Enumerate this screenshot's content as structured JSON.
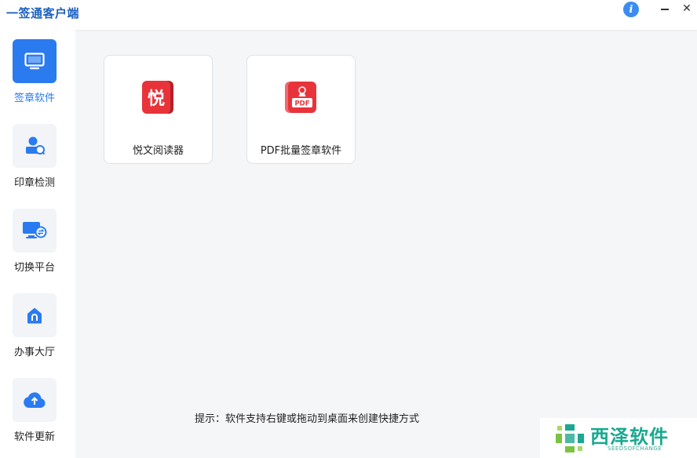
{
  "window": {
    "title": "一签通客户端"
  },
  "titlebar": {
    "info_glyph": "i",
    "close_glyph": "✕"
  },
  "sidebar": {
    "items": [
      {
        "label": "签章软件",
        "icon": "monitor-icon",
        "active": true
      },
      {
        "label": "印章检测",
        "icon": "stamp-search-icon",
        "active": false
      },
      {
        "label": "切换平台",
        "icon": "platform-switch-icon",
        "active": false
      },
      {
        "label": "办事大厅",
        "icon": "home-icon",
        "active": false
      },
      {
        "label": "软件更新",
        "icon": "cloud-upload-icon",
        "active": false
      }
    ]
  },
  "apps": [
    {
      "label": "悦文阅读器",
      "icon": "yuewen-reader-icon",
      "icon_text": "悦"
    },
    {
      "label": "PDF批量签章软件",
      "icon": "pdf-stamp-icon",
      "icon_text": "PDF"
    }
  ],
  "footer": {
    "hint": "提示：软件支持右键或拖动到桌面来创建快捷方式"
  },
  "watermark": {
    "text": "西泽软件",
    "sub": "SEEDSOFCHANGE"
  },
  "colors": {
    "accent": "#2a7bf0",
    "title": "#1b5fbf",
    "app_red": "#e8333a",
    "watermark": "#1aa88f"
  }
}
